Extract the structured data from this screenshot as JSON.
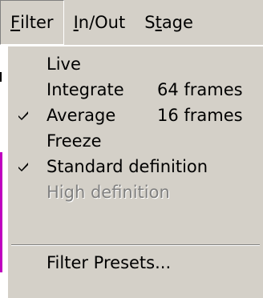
{
  "menubar": {
    "items": [
      {
        "pre": "",
        "key": "F",
        "post": "ilter"
      },
      {
        "pre": "",
        "key": "I",
        "post": "n/Out"
      },
      {
        "pre": "S",
        "key": "t",
        "post": "age"
      }
    ]
  },
  "dropdown": {
    "items": [
      {
        "label": "Live",
        "accel": "",
        "checked": false,
        "enabled": true
      },
      {
        "label": "Integrate",
        "accel": "64 frames",
        "checked": false,
        "enabled": true
      },
      {
        "label": "Average",
        "accel": "16 frames",
        "checked": true,
        "enabled": true
      },
      {
        "label": "Freeze",
        "accel": "",
        "checked": false,
        "enabled": true
      },
      {
        "label": "Standard definition",
        "accel": "",
        "checked": true,
        "enabled": true
      },
      {
        "label": "High definition",
        "accel": "",
        "checked": false,
        "enabled": false
      },
      {
        "label": "Filter Presets...",
        "accel": "",
        "checked": false,
        "enabled": true
      }
    ]
  },
  "icons": {
    "check": "checkmark-icon"
  },
  "colors": {
    "menu_face": "#d4d0c8",
    "disabled_text": "#808080",
    "background_trace": "#c000c0"
  }
}
